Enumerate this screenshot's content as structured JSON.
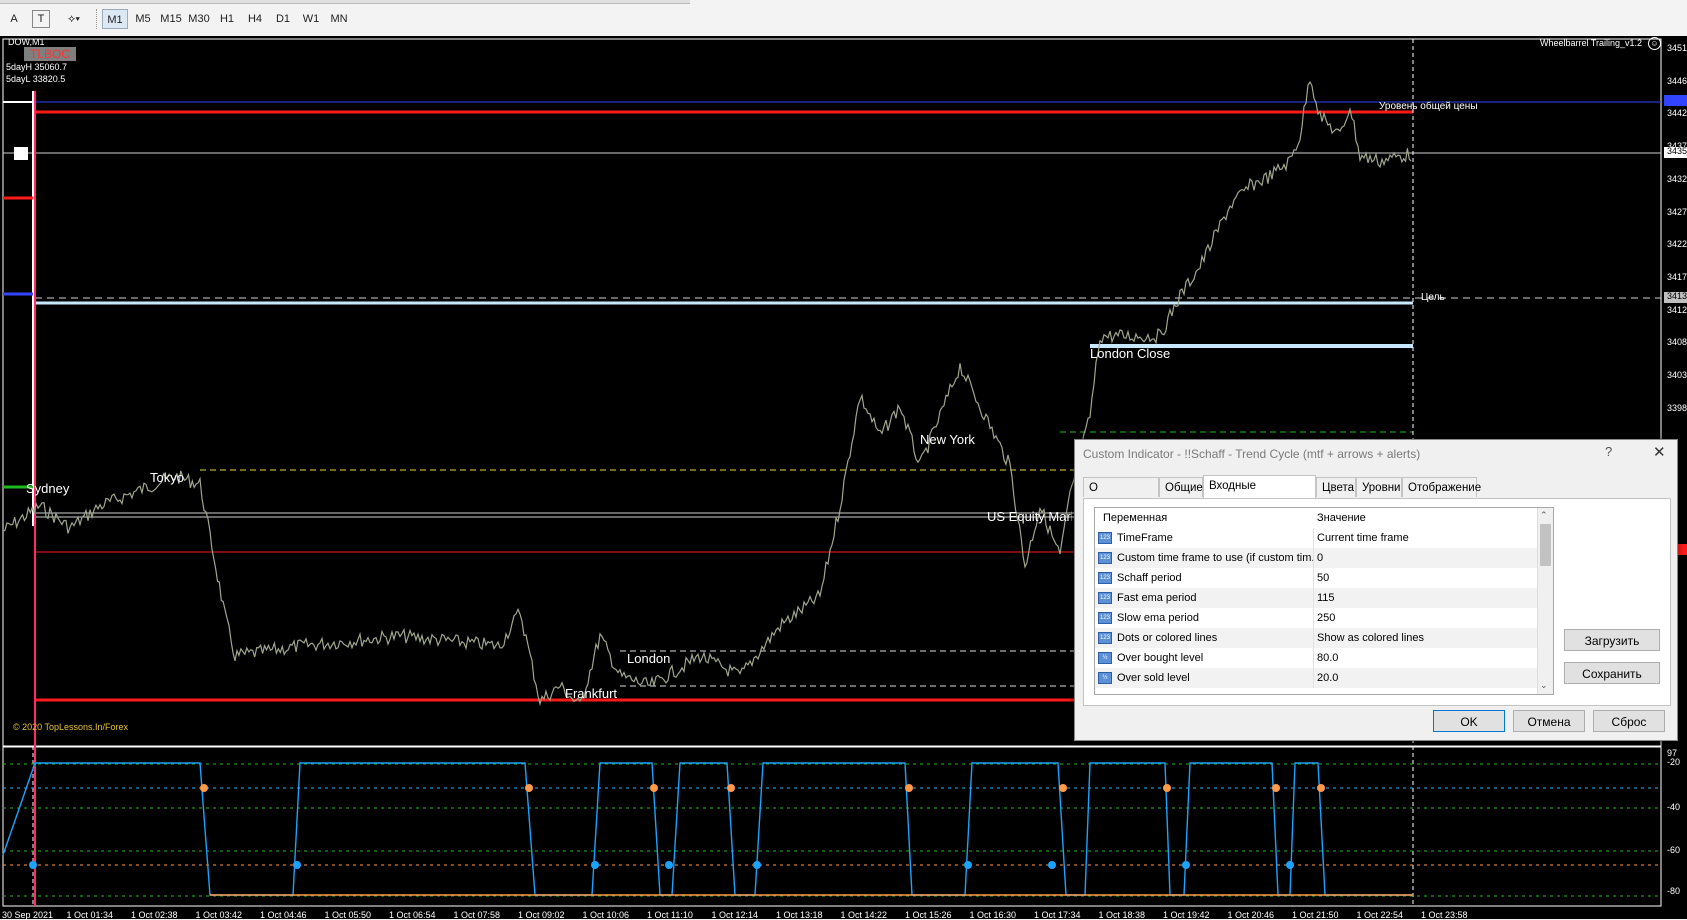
{
  "toolbar": {
    "tools": [
      {
        "label": "A",
        "icon": "text-tool-icon"
      },
      {
        "label": "T",
        "icon": "text-label-tool-icon"
      },
      {
        "label": "⟡▾",
        "icon": "shapes-dropdown-icon"
      }
    ],
    "timeframes": [
      "M1",
      "M5",
      "M15",
      "M30",
      "H1",
      "H4",
      "D1",
      "W1",
      "MN"
    ],
    "active_timeframe": "M1"
  },
  "chart": {
    "symbol": "DOW,M1",
    "indicator_badge": "TLBOC",
    "day_high": "5dayH 35060.7",
    "day_low": "5dayL 33820.5",
    "expert_name": "Wheelbarrel Trailing_v1.2",
    "copyright": "© 2020 TopLessons.In/Forex",
    "level_label": "Уровень общей цены",
    "target_label": "Цель",
    "sessions": [
      "Sydney",
      "Tokyo",
      "Frankfurt",
      "London",
      "New York",
      "US Equity Market",
      "London Close"
    ],
    "price_axis": [
      "3451",
      "3446",
      "3442",
      "3437",
      "3432",
      "3427",
      "3422",
      "3417",
      "3412",
      "3408",
      "3403",
      "3398"
    ],
    "price_axis_tags": [
      "3435",
      "3413"
    ],
    "osc_axis": [
      "-20",
      "-40",
      "-60",
      "-80"
    ],
    "osc_top_value": "97",
    "time_axis": [
      "30 Sep 2021",
      "1 Oct 01:34",
      "1 Oct 02:38",
      "1 Oct 03:42",
      "1 Oct 04:46",
      "1 Oct 05:50",
      "1 Oct 06:54",
      "1 Oct 07:58",
      "1 Oct 09:02",
      "1 Oct 10:06",
      "1 Oct 11:10",
      "1 Oct 12:14",
      "1 Oct 13:18",
      "1 Oct 14:22",
      "1 Oct 15:26",
      "1 Oct 16:30",
      "1 Oct 17:34",
      "1 Oct 18:38",
      "1 Oct 19:42",
      "1 Oct 20:46",
      "1 Oct 21:50",
      "1 Oct 22:54",
      "1 Oct 23:58"
    ]
  },
  "dialog": {
    "title": "Custom Indicator - !!Schaff - Trend Cycle (mtf + arrows + alerts)",
    "help": "?",
    "close": "✕",
    "tabs": [
      "О программе",
      "Общие",
      "Входные параметры",
      "Цвета",
      "Уровни",
      "Отображение"
    ],
    "active_tab": "Входные параметры",
    "columns": {
      "variable": "Переменная",
      "value": "Значение"
    },
    "params": [
      {
        "name": "TimeFrame",
        "value": "Current time frame",
        "icon": "123"
      },
      {
        "name": "Custom time frame to use (if custom tim...",
        "value": "0",
        "icon": "123"
      },
      {
        "name": "Schaff period",
        "value": "50",
        "icon": "123"
      },
      {
        "name": "Fast ema period",
        "value": "115",
        "icon": "123"
      },
      {
        "name": "Slow ema period",
        "value": "250",
        "icon": "123"
      },
      {
        "name": "Dots or colored lines",
        "value": "Show as colored lines",
        "icon": "123"
      },
      {
        "name": "Over bought level",
        "value": "80.0",
        "icon": "½"
      },
      {
        "name": "Over sold level",
        "value": "20.0",
        "icon": "½"
      }
    ],
    "buttons": {
      "load": "Загрузить",
      "save": "Сохранить",
      "ok": "OK",
      "cancel": "Отмена",
      "reset": "Сброс"
    }
  },
  "colors": {
    "chart_bg": "#000000",
    "price_line": "#8fa0a8",
    "level_red": "#ff1a1a",
    "target_line": "#c8e8ff",
    "osc_line": "#1aa3ff",
    "osc_down": "#ff9a4a"
  }
}
